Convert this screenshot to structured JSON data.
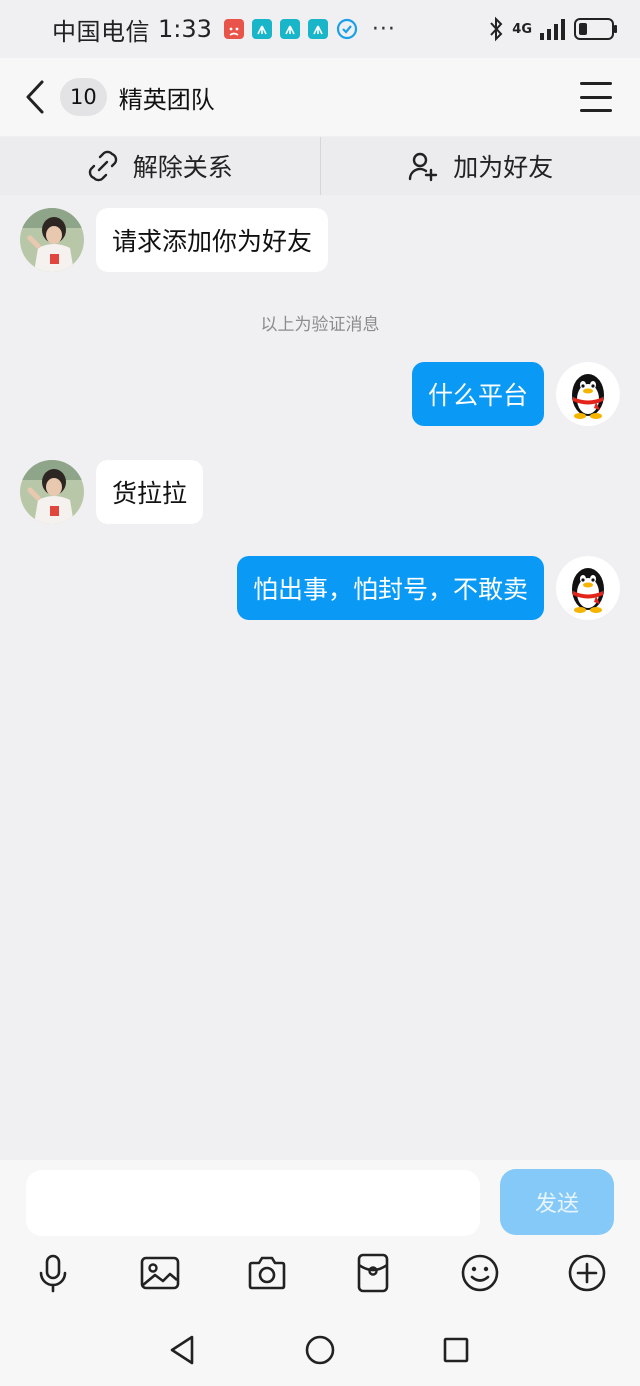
{
  "status_bar": {
    "carrier": "中国电信",
    "time": "1:33",
    "more": "···",
    "network": "4G",
    "icons": [
      "weibo-notify-icon",
      "huawei-app-icon",
      "huawei-app-icon",
      "huawei-app-icon",
      "check-shield-icon",
      "bluetooth-icon",
      "signal-icon",
      "battery-icon"
    ]
  },
  "nav": {
    "unread_count": "10",
    "title": "精英团队"
  },
  "actions": {
    "unlink_label": "解除关系",
    "add_friend_label": "加为好友"
  },
  "messages": [
    {
      "side": "in",
      "text": "请求添加你为好友"
    },
    {
      "side": "system",
      "text": "以上为验证消息"
    },
    {
      "side": "out",
      "text": "什么平台"
    },
    {
      "side": "in",
      "text": "货拉拉"
    },
    {
      "side": "out",
      "text": "怕出事，怕封号，不敢卖"
    }
  ],
  "input": {
    "value": "",
    "send_label": "发送"
  },
  "toolbar": [
    "microphone-icon",
    "image-icon",
    "camera-icon",
    "red-packet-icon",
    "emoji-icon",
    "plus-icon"
  ],
  "colors": {
    "accent": "#0a9af5",
    "send_disabled": "#84c9f7",
    "background": "#f0f0f2"
  }
}
